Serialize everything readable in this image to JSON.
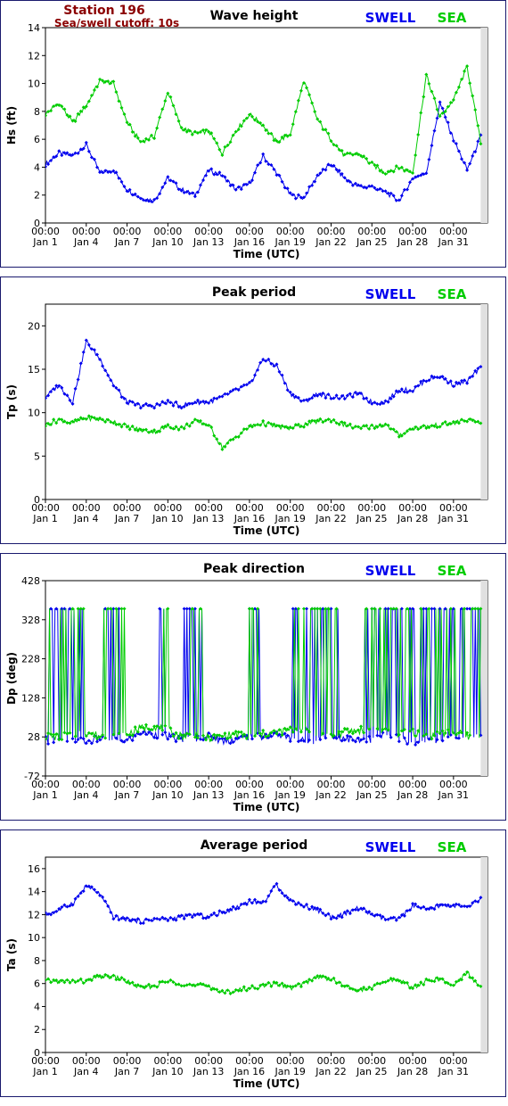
{
  "station": {
    "name": "Station 196",
    "cutoff": "Sea/swell cutoff: 10s"
  },
  "colors": {
    "swell": "#0000ee",
    "sea": "#00cc00",
    "station": "#8b0000",
    "frame": "#1a1a6e",
    "plot_bg_right": "#e0e0e0"
  },
  "legend": {
    "swell": "SWELL",
    "sea": "SEA"
  },
  "x_axis": {
    "label": "Time (UTC)",
    "range_days": [
      0,
      32.5
    ],
    "ticks": [
      {
        "day": 0,
        "time": "00:00",
        "date": "Jan 1"
      },
      {
        "day": 3,
        "time": "00:00",
        "date": "Jan 4"
      },
      {
        "day": 6,
        "time": "00:00",
        "date": "Jan 7"
      },
      {
        "day": 9,
        "time": "00:00",
        "date": "Jan 10"
      },
      {
        "day": 12,
        "time": "00:00",
        "date": "Jan 13"
      },
      {
        "day": 15,
        "time": "00:00",
        "date": "Jan 16"
      },
      {
        "day": 18,
        "time": "00:00",
        "date": "Jan 19"
      },
      {
        "day": 21,
        "time": "00:00",
        "date": "Jan 22"
      },
      {
        "day": 24,
        "time": "00:00",
        "date": "Jan 25"
      },
      {
        "day": 27,
        "time": "00:00",
        "date": "Jan 28"
      },
      {
        "day": 30,
        "time": "00:00",
        "date": "Jan 31"
      }
    ]
  },
  "chart_data": [
    {
      "type": "line",
      "title": "Wave height",
      "ylabel": "Hs (ft)",
      "ylim": [
        0,
        14
      ],
      "yticks": [
        "0",
        "2",
        "4",
        "6",
        "8",
        "10",
        "12",
        "14"
      ],
      "x": [
        0,
        1,
        2,
        3,
        4,
        5,
        6,
        7,
        8,
        9,
        10,
        11,
        12,
        13,
        14,
        15,
        16,
        17,
        18,
        19,
        20,
        21,
        22,
        23,
        24,
        25,
        26,
        27,
        28,
        29,
        30,
        31,
        32
      ],
      "series": [
        {
          "name": "SWELL",
          "values": [
            4.2,
            5.0,
            4.8,
            5.6,
            3.6,
            3.8,
            2.4,
            1.8,
            1.6,
            3.2,
            2.4,
            2.0,
            3.8,
            3.4,
            2.4,
            2.8,
            4.8,
            3.6,
            2.0,
            1.8,
            3.4,
            4.2,
            3.2,
            2.6,
            2.6,
            2.2,
            1.6,
            3.2,
            3.6,
            8.6,
            6.0,
            3.8,
            6.2
          ]
        },
        {
          "name": "SEA",
          "values": [
            7.8,
            8.6,
            7.2,
            8.4,
            10.2,
            10.0,
            7.2,
            5.8,
            6.2,
            9.4,
            6.8,
            6.4,
            6.6,
            5.0,
            6.6,
            7.8,
            7.0,
            5.8,
            6.4,
            10.2,
            7.4,
            6.0,
            4.8,
            5.0,
            4.2,
            3.6,
            4.0,
            3.6,
            10.6,
            7.6,
            8.8,
            11.2,
            5.8
          ]
        }
      ]
    },
    {
      "type": "line",
      "title": "Peak period",
      "ylabel": "Tp (s)",
      "ylim": [
        0,
        22.5
      ],
      "yticks": [
        "0",
        "5",
        "10",
        "15",
        "20"
      ],
      "x": [
        0,
        1,
        2,
        3,
        4,
        5,
        6,
        7,
        8,
        9,
        10,
        11,
        12,
        13,
        14,
        15,
        16,
        17,
        18,
        19,
        20,
        21,
        22,
        23,
        24,
        25,
        26,
        27,
        28,
        29,
        30,
        31,
        32
      ],
      "series": [
        {
          "name": "SWELL",
          "values": [
            11.8,
            13.2,
            11.2,
            18.2,
            16.2,
            13.2,
            11.2,
            10.8,
            10.8,
            11.2,
            10.8,
            11.2,
            11.2,
            11.8,
            12.6,
            13.2,
            16.2,
            15.4,
            12.2,
            11.2,
            12.2,
            11.8,
            11.8,
            12.2,
            11.2,
            11.2,
            12.6,
            12.6,
            13.8,
            14.2,
            13.2,
            13.6,
            15.2
          ]
        },
        {
          "name": "SEA",
          "values": [
            8.6,
            9.2,
            8.8,
            9.4,
            9.2,
            9.0,
            8.4,
            8.0,
            7.8,
            8.4,
            8.2,
            9.0,
            8.6,
            6.0,
            7.2,
            8.4,
            8.8,
            8.4,
            8.2,
            8.6,
            9.0,
            9.2,
            8.6,
            8.2,
            8.4,
            8.6,
            7.4,
            8.2,
            8.4,
            8.6,
            8.8,
            9.2,
            8.8
          ]
        }
      ]
    },
    {
      "type": "line",
      "title": "Peak direction",
      "ylabel": "Dp (deg)",
      "ylim": [
        -72,
        428
      ],
      "yticks": [
        "-72",
        "28",
        "128",
        "228",
        "328",
        "428"
      ],
      "x": [
        0,
        1,
        2,
        3,
        4,
        5,
        6,
        7,
        8,
        9,
        10,
        11,
        12,
        13,
        14,
        15,
        16,
        17,
        18,
        19,
        20,
        21,
        22,
        23,
        24,
        25,
        26,
        27,
        28,
        29,
        30,
        31,
        32
      ],
      "series": [
        {
          "name": "SWELL",
          "values": [
            20,
            18,
            22,
            15,
            25,
            20,
            18,
            40,
            35,
            30,
            20,
            25,
            30,
            18,
            22,
            28,
            30,
            35,
            25,
            18,
            20,
            30,
            25,
            18,
            20,
            35,
            25,
            15,
            18,
            20,
            28,
            25,
            30
          ]
        },
        {
          "name": "SEA",
          "values": [
            30,
            28,
            35,
            40,
            30,
            28,
            35,
            50,
            55,
            45,
            30,
            35,
            25,
            30,
            35,
            28,
            35,
            40,
            45,
            50,
            35,
            30,
            40,
            45,
            50,
            40,
            35,
            40,
            30,
            35,
            40,
            30,
            35
          ]
        }
      ],
      "note_wrap": "Peak direction series wrap between near 20 and near 360 deg; vertical spikes drawn where wrap occurs"
    },
    {
      "type": "line",
      "title": "Average period",
      "ylabel": "Ta (s)",
      "ylim": [
        0,
        17
      ],
      "yticks": [
        "0",
        "2",
        "4",
        "6",
        "8",
        "10",
        "12",
        "14",
        "16"
      ],
      "x": [
        0,
        1,
        2,
        3,
        4,
        5,
        6,
        7,
        8,
        9,
        10,
        11,
        12,
        13,
        14,
        15,
        16,
        17,
        18,
        19,
        20,
        21,
        22,
        23,
        24,
        25,
        26,
        27,
        28,
        29,
        30,
        31,
        32
      ],
      "series": [
        {
          "name": "SWELL",
          "values": [
            12.0,
            12.4,
            13.0,
            14.5,
            13.8,
            11.8,
            11.6,
            11.4,
            11.6,
            11.6,
            11.8,
            12.0,
            11.8,
            12.2,
            12.6,
            13.2,
            13.0,
            14.6,
            13.2,
            12.8,
            12.4,
            11.8,
            12.0,
            12.6,
            12.0,
            11.6,
            11.6,
            12.8,
            12.4,
            12.8,
            12.8,
            12.6,
            13.4
          ]
        },
        {
          "name": "SEA",
          "values": [
            6.2,
            6.2,
            6.2,
            6.2,
            6.6,
            6.6,
            6.2,
            5.6,
            5.8,
            6.2,
            6.0,
            5.8,
            5.8,
            5.2,
            5.4,
            5.6,
            5.8,
            6.0,
            5.6,
            6.0,
            6.6,
            6.4,
            5.8,
            5.4,
            5.6,
            6.2,
            6.4,
            5.6,
            6.2,
            6.4,
            5.8,
            7.0,
            5.6
          ]
        }
      ]
    }
  ]
}
